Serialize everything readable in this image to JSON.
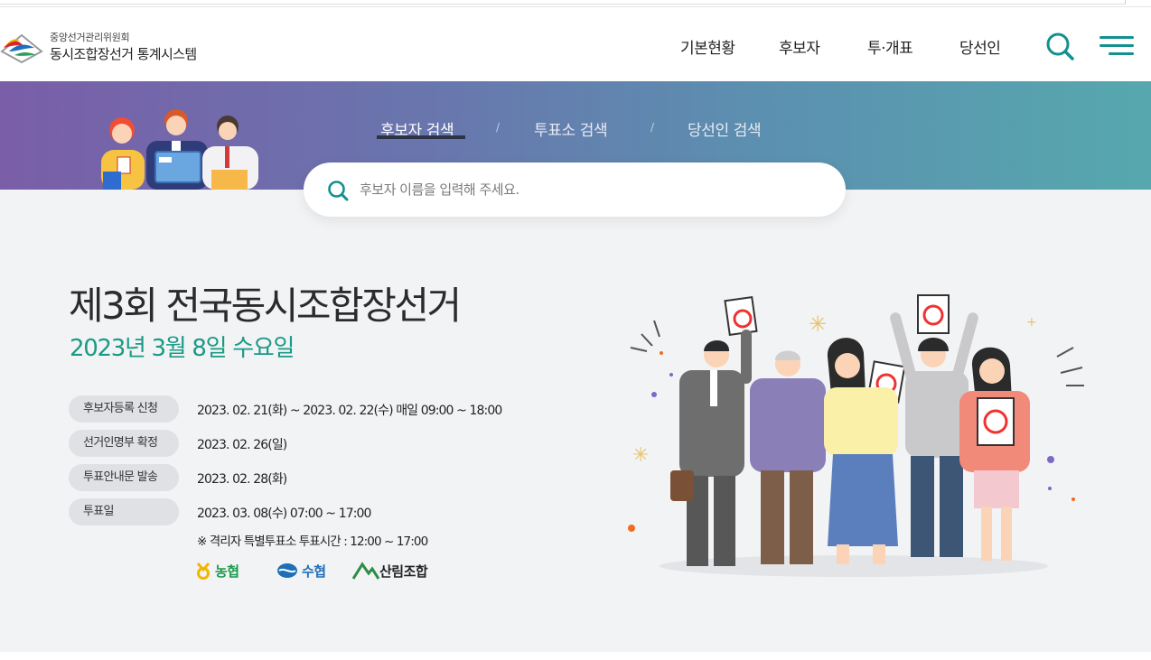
{
  "header": {
    "org_name": "중앙선거관리위원회",
    "system_name": "동시조합장선거 통계시스템",
    "nav": [
      "기본현황",
      "후보자",
      "투·개표",
      "당선인"
    ]
  },
  "banner": {
    "tabs": [
      "후보자 검색",
      "투표소 검색",
      "당선인 검색"
    ],
    "separator": "/",
    "search_placeholder": "후보자 이름을 입력해 주세요."
  },
  "election": {
    "title": "제3회 전국동시조합장선거",
    "date": "2023년 3월 8일 수요일",
    "schedule": [
      {
        "label": "후보자등록 신청",
        "value": "2023. 02. 21(화) ~ 2023. 02. 22(수) 매일 09:00 ~ 18:00"
      },
      {
        "label": "선거인명부 확정",
        "value": "2023. 02. 26(일)"
      },
      {
        "label": "투표안내문 발송",
        "value": "2023. 02. 28(화)"
      },
      {
        "label": "투표일",
        "value": "2023. 03. 08(수) 07:00 ~ 17:00"
      }
    ],
    "note": "※ 격리자 특별투표소 투표시간 : 12:00 ~ 17:00",
    "partners": [
      "농협",
      "수협",
      "산림조합"
    ]
  },
  "colors": {
    "accent": "#13908f",
    "date_green": "#1b9a86",
    "nh_yellow": "#f3b600",
    "nh_green": "#1c9a4a",
    "suhyup_blue": "#1f6fb8",
    "forest_green": "#2c8d45"
  },
  "icons": {
    "search": "search-icon",
    "menu": "hamburger-menu-icon",
    "logo": "nec-logo-icon"
  }
}
